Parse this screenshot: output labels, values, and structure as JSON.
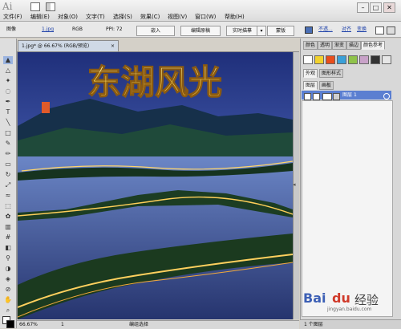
{
  "app": {
    "logo": "Ai"
  },
  "menu": [
    "文件(F)",
    "编辑(E)",
    "对象(O)",
    "文字(T)",
    "选择(S)",
    "效果(C)",
    "视图(V)",
    "窗口(W)",
    "帮助(H)"
  ],
  "window_controls": {
    "minimize": "–",
    "maximize": "□",
    "close": "✕"
  },
  "control_bar": {
    "object_type": "图像",
    "filename": "1.jpg",
    "color_mode": "RGB",
    "ppi": "PPI: 72",
    "embed": "嵌入",
    "edit_original": "编辑原稿",
    "live_trace": "实时描摹",
    "trace_dropdown": "▾",
    "mask": "蒙版",
    "transparency": "不透...",
    "align": "对齐",
    "transform": "变换"
  },
  "document": {
    "tab_title": "1.jpg* @ 66.67% (RGB/预览)",
    "close": "×",
    "artwork_title": "东湖风光"
  },
  "status_bar": {
    "zoom": "66.67%",
    "artboard": "1",
    "status": "编组选择"
  },
  "panels": {
    "swatches_tabs": [
      "颜色",
      "透明",
      "渐变",
      "描边",
      "颜色参考"
    ],
    "appearance_tabs": [
      "外观",
      "图形样式"
    ],
    "layers_tabs": [
      "图层",
      "画板"
    ],
    "layer_name": "图层",
    "layer_number": "1",
    "layers_count": "1 个图层",
    "swatch_colors": [
      "#ffffff",
      "#f2d22e",
      "#e94e1b",
      "#3aa0d8",
      "#8fc34a",
      "#c8a2c8",
      "#333333",
      "#e6e6e6"
    ]
  },
  "watermark": {
    "brand": "Bai",
    "paw": "du",
    "sub": "经验",
    "url": "jingyan.baidu.com"
  }
}
